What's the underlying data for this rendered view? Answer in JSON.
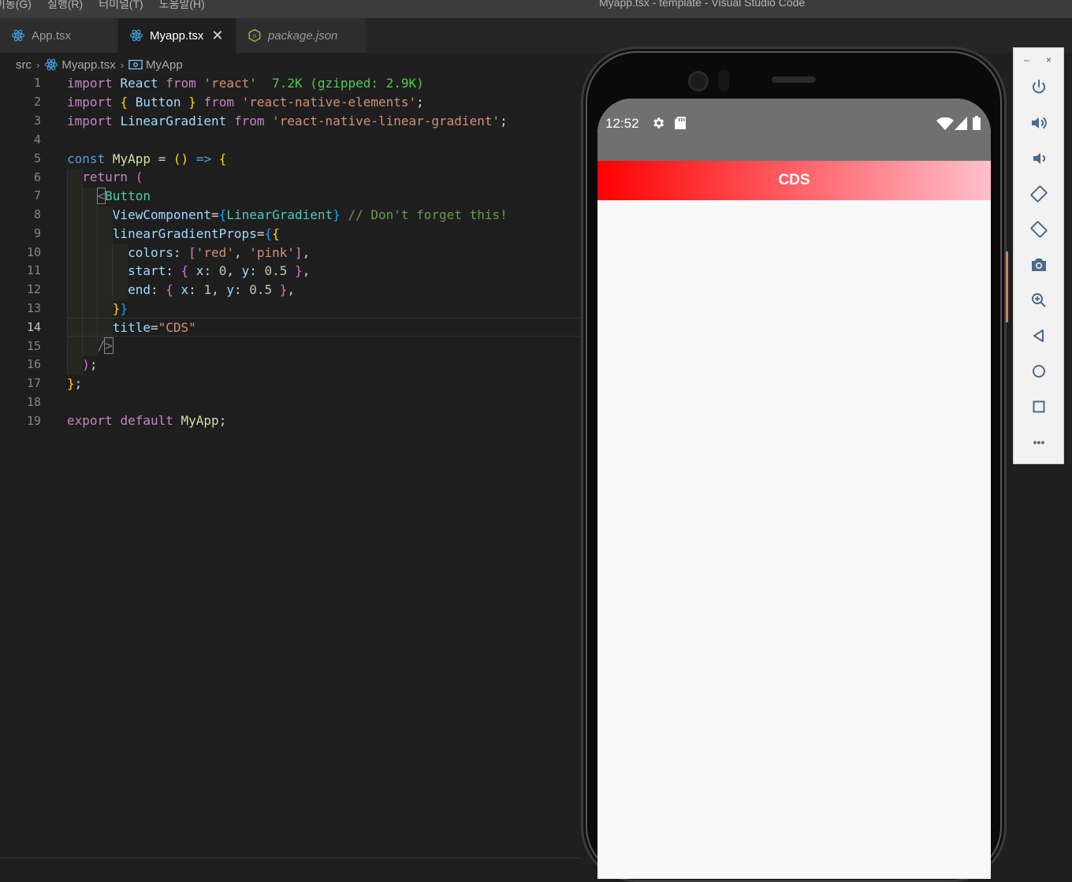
{
  "menu": {
    "items": [
      "이동(G)",
      "실행(R)",
      "터미널(T)",
      "도움말(H)"
    ]
  },
  "window": {
    "title": "Myapp.tsx - template - Visual Studio Code"
  },
  "tabs": [
    {
      "label": "App.tsx",
      "icon": "react-icon"
    },
    {
      "label": "Myapp.tsx",
      "icon": "react-icon",
      "active": true,
      "close": "✕"
    },
    {
      "label": "package.json",
      "icon": "nodejs-icon"
    }
  ],
  "breadcrumb": {
    "folder": "src",
    "file": "Myapp.tsx",
    "symbol": "MyApp",
    "separator": "›"
  },
  "editor": {
    "line_numbers": [
      "1",
      "2",
      "3",
      "4",
      "5",
      "6",
      "7",
      "8",
      "9",
      "10",
      "11",
      "12",
      "13",
      "14",
      "15",
      "16",
      "17",
      "18",
      "19"
    ],
    "current_line": "14",
    "code": {
      "l1": {
        "kw": "import",
        "id": "React",
        "from": "from",
        "str": "'react'",
        "hint": "7.2K (gzipped: 2.9K)"
      },
      "l2": {
        "kw": "import",
        "ob": "{",
        "id": "Button",
        "cb": "}",
        "from": "from",
        "str": "'react-native-elements'",
        "semi": ";"
      },
      "l3": {
        "kw": "import",
        "id": "LinearGradient",
        "from": "from",
        "str": "'react-native-linear-gradient'",
        "semi": ";"
      },
      "l5": {
        "const": "const",
        "name": "MyApp",
        "eq": "=",
        "paren": "()",
        "arrow": "=>",
        "brace": "{"
      },
      "l6": {
        "ret": "return",
        "paren": "("
      },
      "l7": {
        "lt": "<",
        "tag": "Button"
      },
      "l8": {
        "attr": "ViewComponent",
        "eq": "=",
        "ob": "{",
        "val": "LinearGradient",
        "cb": "}",
        "comment": "// Don't forget this!"
      },
      "l9": {
        "attr": "linearGradientProps",
        "eq": "=",
        "ob": "{",
        "ob2": "{"
      },
      "l10": {
        "key": "colors",
        "colon": ":",
        "ob": "[",
        "s1": "'red'",
        "comma": ",",
        "s2": "'pink'",
        "cb": "]",
        "tail": ","
      },
      "l11": {
        "key": "start",
        "colon": ":",
        "ob": "{",
        "kx": "x",
        "vx": "0",
        "ky": "y",
        "vy": "0.5",
        "cb": "}",
        "tail": ","
      },
      "l12": {
        "key": "end",
        "colon": ":",
        "ob": "{",
        "kx": "x",
        "vx": "1",
        "ky": "y",
        "vy": "0.5",
        "cb": "}",
        "tail": ","
      },
      "l13": {
        "cb2": "}",
        "cb": "}"
      },
      "l14": {
        "attr": "title",
        "eq": "=",
        "str": "\"CDS\""
      },
      "l15": {
        "slash": "/",
        "gt": ">"
      },
      "l16": {
        "paren": ")",
        "semi": ";"
      },
      "l17": {
        "brace": "}",
        "semi": ";"
      },
      "l19": {
        "kw": "export",
        "kw2": "default",
        "id": "MyApp",
        "semi": ";"
      }
    }
  },
  "emulator": {
    "time": "12:52",
    "button_title": "CDS",
    "gradient_colors": [
      "#ff0000",
      "#ffc0cb"
    ],
    "status_icons": [
      "gear-icon",
      "sd-card-icon",
      "wifi-icon",
      "signal-icon",
      "battery-icon"
    ],
    "window_controls": {
      "minimize": "–",
      "close": "×"
    },
    "toolbar": [
      "power-icon",
      "volume-up-icon",
      "volume-down-icon",
      "rotate-left-icon",
      "rotate-right-icon",
      "camera-icon",
      "zoom-icon",
      "back-icon",
      "home-icon",
      "overview-icon",
      "more-icon"
    ],
    "more_label": "•••"
  },
  "colors": {
    "editor_bg": "#1e1e1e",
    "keyword": "#c586c0",
    "string": "#ce9178",
    "variable": "#9cdcfe"
  }
}
